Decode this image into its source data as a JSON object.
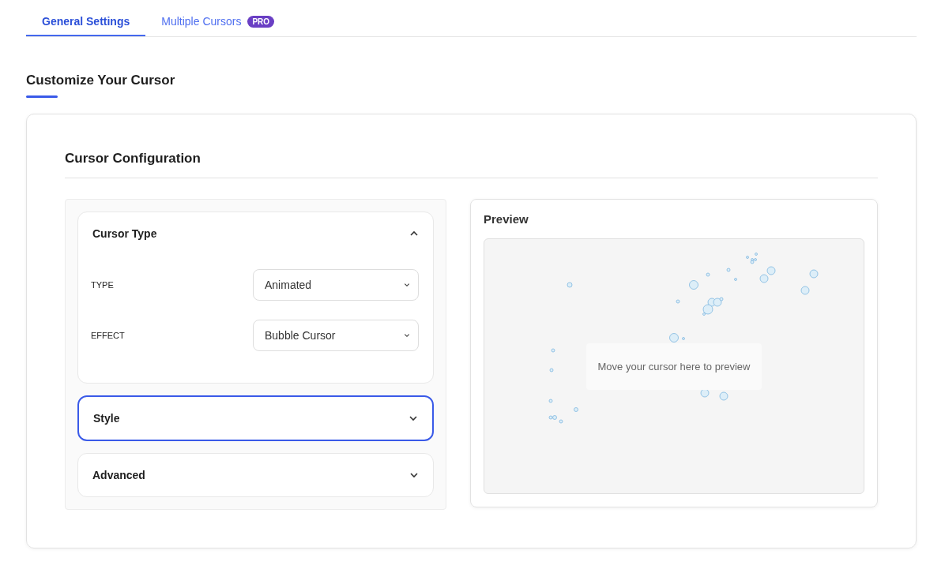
{
  "tabs": [
    {
      "label": "General Settings",
      "selected": true
    },
    {
      "label": "Multiple Cursors",
      "selected": false,
      "badge": "PRO"
    }
  ],
  "page_title": "Customize Your Cursor",
  "card": {
    "title": "Cursor Configuration",
    "sections": [
      {
        "title": "Cursor Type",
        "expanded": true,
        "focused": false,
        "fields": [
          {
            "label": "TYPE",
            "value": "Animated"
          },
          {
            "label": "EFFECT",
            "value": "Bubble Cursor"
          }
        ]
      },
      {
        "title": "Style",
        "expanded": false,
        "focused": true
      },
      {
        "title": "Advanced",
        "expanded": false,
        "focused": false
      }
    ],
    "preview": {
      "title": "Preview",
      "message": "Move your cursor here to preview"
    }
  }
}
